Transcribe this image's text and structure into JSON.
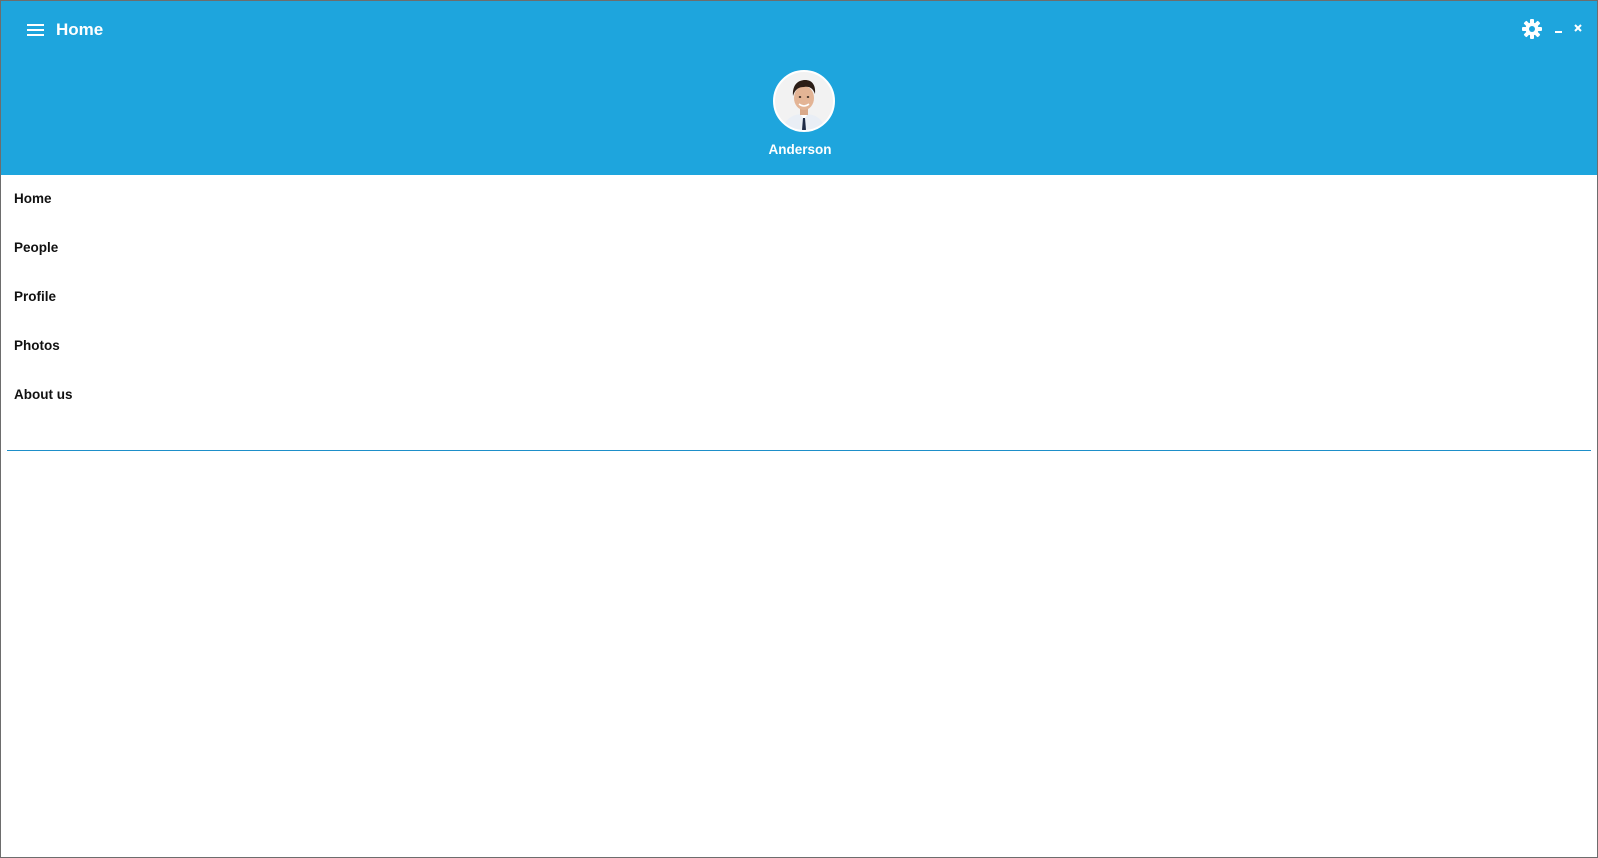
{
  "window": {
    "title": "Home"
  },
  "colors": {
    "header_background": "#1ea5dd",
    "header_text": "#ffffff",
    "nav_text": "#111111",
    "divider": "#1e8fc9"
  },
  "icons": {
    "menu": "hamburger-menu-icon",
    "settings": "gear-icon",
    "minimize": "minimize-icon",
    "close": "close-icon",
    "avatar": "user-avatar-photo"
  },
  "profile": {
    "name": "Anderson"
  },
  "nav": {
    "items": [
      {
        "label": "Home"
      },
      {
        "label": "People"
      },
      {
        "label": "Profile"
      },
      {
        "label": "Photos"
      },
      {
        "label": "About us"
      }
    ]
  }
}
